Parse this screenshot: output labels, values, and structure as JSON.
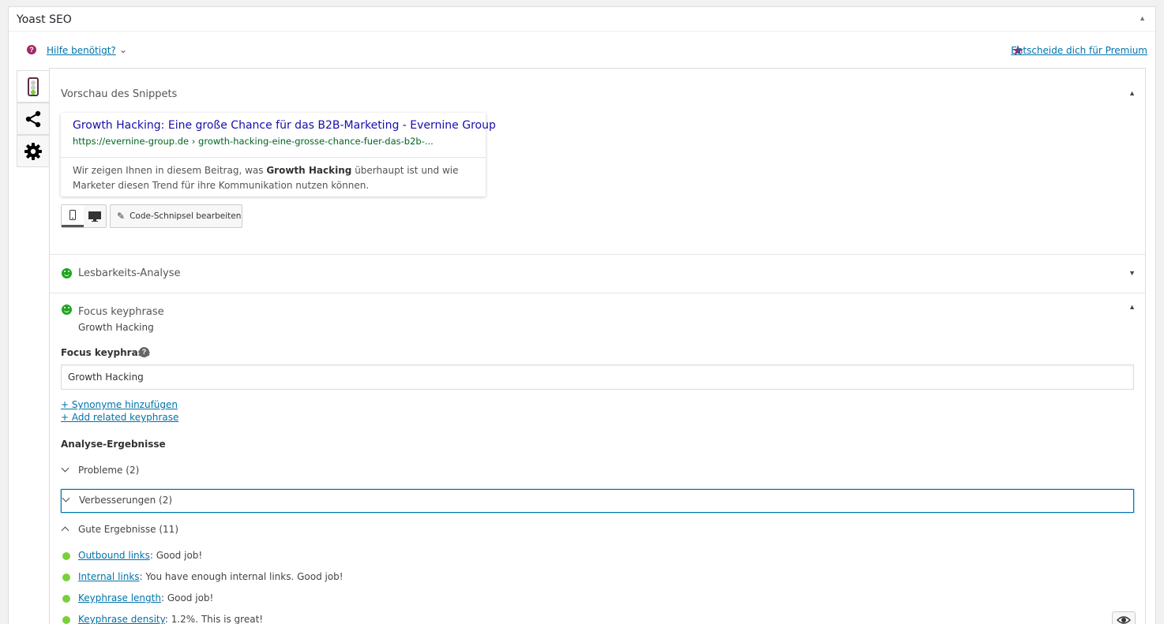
{
  "panel": {
    "title": "Yoast SEO"
  },
  "help": {
    "label": "Hilfe benötigt?",
    "premium": "Entscheide dich für Premium"
  },
  "snippet": {
    "section_title": "Vorschau des Snippets",
    "title": "Growth Hacking: Eine große Chance für das B2B-Marketing - Evernine Group",
    "url": "https://evernine-group.de › growth-hacking-eine-grosse-chance-fuer-das-b2b-...",
    "desc_before": "Wir zeigen Ihnen in diesem Beitrag, was ",
    "desc_bold": "Growth Hacking",
    "desc_after": " überhaupt ist und wie Marketer diesen Trend für ihre Kommunikation nutzen können.",
    "edit_button": "Code-Schnipsel bearbeiten"
  },
  "readability": {
    "title": "Lesbarkeits-Analyse"
  },
  "focus": {
    "title": "Focus keyphrase",
    "subtitle": "Growth Hacking",
    "field_label": "Focus keyphrase",
    "value": "Growth Hacking",
    "add_synonyms": "+ Synonyme hinzufügen",
    "add_related": "+ Add related keyphrase",
    "results_heading": "Analyse-Ergebnisse",
    "groups": [
      "Probleme (2)",
      "Verbesserungen (2)",
      "Gute Ergebnisse (11)"
    ],
    "results": [
      {
        "link": "Outbound links",
        "text": ": Good job!"
      },
      {
        "link": "Internal links",
        "text": ": You have enough internal links. Good job!"
      },
      {
        "link": "Keyphrase length",
        "text": ": Good job!"
      },
      {
        "link": "Keyphrase density",
        "text": ": 1.2%. This is great!"
      }
    ]
  },
  "colors": {
    "brand": "#a4286a",
    "good": "#7ad03a",
    "link": "#0073aa"
  }
}
